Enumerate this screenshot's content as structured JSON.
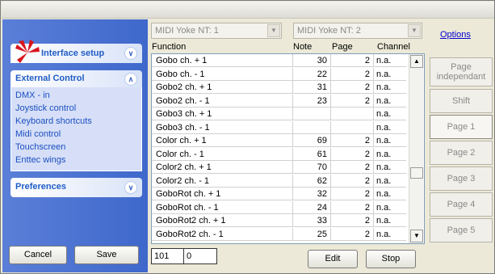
{
  "sidebar": {
    "interface_setup": "Interface setup",
    "external_control": {
      "title": "External Control",
      "items": [
        "DMX - in",
        "Joystick control",
        "Keyboard shortcuts",
        "Midi control",
        "Touchscreen",
        "Enttec wings"
      ]
    },
    "preferences": "Preferences",
    "cancel": "Cancel",
    "save": "Save"
  },
  "midi": {
    "in_device": "MIDI Yoke NT:  1",
    "out_device": "MIDI Yoke NT:  2",
    "options": "Options"
  },
  "table": {
    "headers": {
      "function": "Function",
      "note": "Note",
      "page": "Page",
      "channel": "Channel"
    },
    "rows": [
      {
        "fn": "Gobo ch. + 1",
        "note": "30",
        "page": "2",
        "ch": "n.a."
      },
      {
        "fn": "Gobo ch. - 1",
        "note": "22",
        "page": "2",
        "ch": "n.a."
      },
      {
        "fn": "Gobo2 ch. + 1",
        "note": "31",
        "page": "2",
        "ch": "n.a."
      },
      {
        "fn": "Gobo2 ch. - 1",
        "note": "23",
        "page": "2",
        "ch": "n.a."
      },
      {
        "fn": "Gobo3 ch. + 1",
        "note": "",
        "page": "",
        "ch": "n.a."
      },
      {
        "fn": "Gobo3 ch. - 1",
        "note": "",
        "page": "",
        "ch": "n.a."
      },
      {
        "fn": "Color ch. + 1",
        "note": "69",
        "page": "2",
        "ch": "n.a."
      },
      {
        "fn": "Color ch. - 1",
        "note": "61",
        "page": "2",
        "ch": "n.a."
      },
      {
        "fn": "Color2 ch. + 1",
        "note": "70",
        "page": "2",
        "ch": "n.a."
      },
      {
        "fn": "Color2 ch. - 1",
        "note": "62",
        "page": "2",
        "ch": "n.a."
      },
      {
        "fn": "GoboRot ch. + 1",
        "note": "32",
        "page": "2",
        "ch": "n.a."
      },
      {
        "fn": "GoboRot ch. - 1",
        "note": "24",
        "page": "2",
        "ch": "n.a."
      },
      {
        "fn": "GoboRot2 ch. + 1",
        "note": "33",
        "page": "2",
        "ch": "n.a."
      },
      {
        "fn": "GoboRot2 ch. - 1",
        "note": "25",
        "page": "2",
        "ch": "n.a."
      }
    ]
  },
  "bottom": {
    "value1": "101",
    "value2": "0",
    "edit": "Edit",
    "stop": "Stop"
  },
  "pages": {
    "page_independent": "Page independant",
    "shift": "Shift",
    "page1": "Page 1",
    "page2": "Page 2",
    "page3": "Page 3",
    "page4": "Page 4",
    "page5": "Page 5"
  },
  "icons": {
    "logo": "app-logo-icon",
    "expand": "chevron-down-icon",
    "collapse": "chevron-up-icon"
  },
  "colors": {
    "sidebar": "#4a70d0",
    "link": "#1c4fc2",
    "accent": "#215dc6"
  }
}
